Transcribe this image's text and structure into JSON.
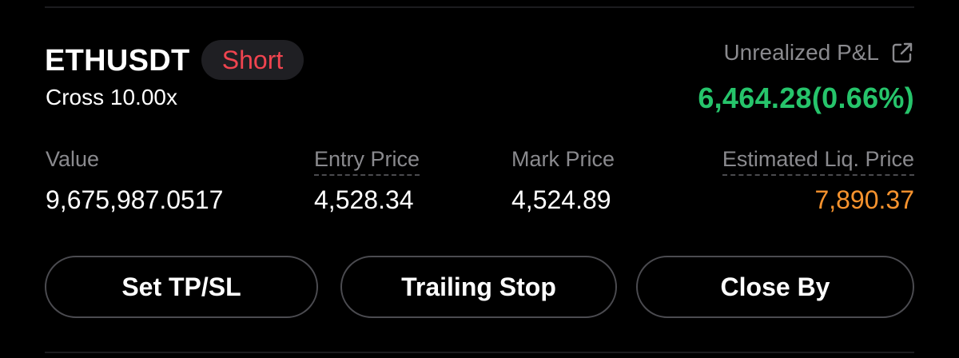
{
  "position": {
    "symbol": "ETHUSDT",
    "side": "Short",
    "margin_mode": "Cross 10.00x"
  },
  "pnl": {
    "label": "Unrealized P&L",
    "value": "6,464.28(0.66%)",
    "icon": "share-external-icon"
  },
  "stats": {
    "value_label": "Value",
    "value": "9,675,987.0517",
    "entry_label": "Entry Price",
    "entry": "4,528.34",
    "mark_label": "Mark Price",
    "mark": "4,524.89",
    "liq_label": "Estimated Liq. Price",
    "liq": "7,890.37"
  },
  "actions": {
    "tpsl": "Set TP/SL",
    "trailing": "Trailing Stop",
    "close": "Close By"
  },
  "colors": {
    "background": "#000000",
    "short": "#f0444f",
    "profit": "#26c46b",
    "liquidation": "#f7932e",
    "muted_text": "#8a8a8e"
  }
}
